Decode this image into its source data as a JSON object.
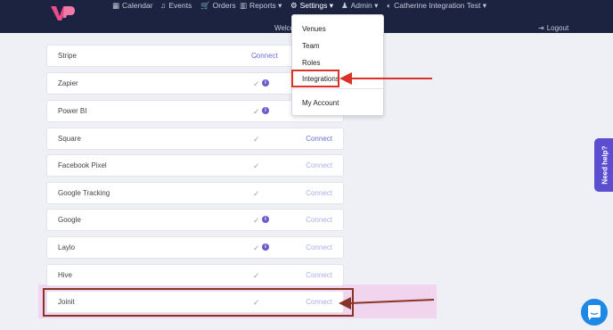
{
  "nav": {
    "items": [
      {
        "icon": "calendar-icon",
        "glyph": "▦",
        "label": "Calendar",
        "caret": ""
      },
      {
        "icon": "music-icon",
        "glyph": "♫",
        "label": "Events",
        "caret": ""
      },
      {
        "icon": "cart-icon",
        "glyph": "🛒",
        "label": "Orders",
        "caret": ""
      },
      {
        "icon": "bank-icon",
        "glyph": "▥",
        "label": "Reports",
        "caret": "▾"
      },
      {
        "icon": "gear-icon",
        "glyph": "⚙",
        "label": "Settings",
        "caret": "▾"
      },
      {
        "icon": "user-icon",
        "glyph": "♟",
        "label": "Admin",
        "caret": "▾"
      },
      {
        "icon": "contrast-icon",
        "glyph": "◐",
        "label": "Catherine Integration Test",
        "caret": "▾"
      }
    ],
    "welcome_text": "Welco",
    "logout_label": "Logout",
    "logout_glyph": "⇥"
  },
  "settings_menu": {
    "items": [
      "Venues",
      "Team",
      "Roles",
      "Integrations"
    ],
    "account_item": "My Account"
  },
  "integrations": [
    {
      "name": "Stripe",
      "info": false,
      "connect": "Connect"
    },
    {
      "name": "Zapier",
      "info": true,
      "connect": ""
    },
    {
      "name": "Power BI",
      "info": true,
      "connect": ""
    },
    {
      "name": "Square",
      "info": false,
      "connect": "Connect"
    },
    {
      "name": "Facebook Pixel",
      "info": false,
      "connect": "Connect"
    },
    {
      "name": "Google Tracking",
      "info": false,
      "connect": "Connect"
    },
    {
      "name": "Google",
      "info": true,
      "connect": "Connect"
    },
    {
      "name": "Laylo",
      "info": true,
      "connect": "Connect"
    },
    {
      "name": "Hive",
      "info": false,
      "connect": "Connect"
    },
    {
      "name": "Joinit",
      "info": false,
      "connect": "Connect"
    }
  ],
  "check_glyph": "✓",
  "info_glyph": "i",
  "help_tab_label": "Need help?",
  "colors": {
    "navbar": "#1b2340",
    "accent": "#6a5acd",
    "highlight_red": "#d93228",
    "highlight_brown": "#8a3427",
    "chat_blue": "#1e88e5"
  }
}
